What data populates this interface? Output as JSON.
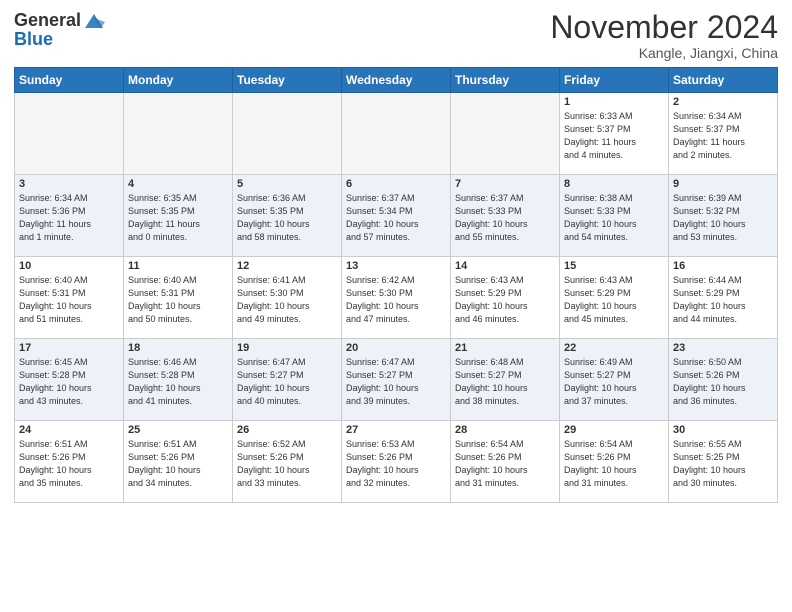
{
  "header": {
    "logo_general": "General",
    "logo_blue": "Blue",
    "month_title": "November 2024",
    "location": "Kangle, Jiangxi, China"
  },
  "weekdays": [
    "Sunday",
    "Monday",
    "Tuesday",
    "Wednesday",
    "Thursday",
    "Friday",
    "Saturday"
  ],
  "weeks": [
    [
      {
        "day": "",
        "info": ""
      },
      {
        "day": "",
        "info": ""
      },
      {
        "day": "",
        "info": ""
      },
      {
        "day": "",
        "info": ""
      },
      {
        "day": "",
        "info": ""
      },
      {
        "day": "1",
        "info": "Sunrise: 6:33 AM\nSunset: 5:37 PM\nDaylight: 11 hours\nand 4 minutes."
      },
      {
        "day": "2",
        "info": "Sunrise: 6:34 AM\nSunset: 5:37 PM\nDaylight: 11 hours\nand 2 minutes."
      }
    ],
    [
      {
        "day": "3",
        "info": "Sunrise: 6:34 AM\nSunset: 5:36 PM\nDaylight: 11 hours\nand 1 minute."
      },
      {
        "day": "4",
        "info": "Sunrise: 6:35 AM\nSunset: 5:35 PM\nDaylight: 11 hours\nand 0 minutes."
      },
      {
        "day": "5",
        "info": "Sunrise: 6:36 AM\nSunset: 5:35 PM\nDaylight: 10 hours\nand 58 minutes."
      },
      {
        "day": "6",
        "info": "Sunrise: 6:37 AM\nSunset: 5:34 PM\nDaylight: 10 hours\nand 57 minutes."
      },
      {
        "day": "7",
        "info": "Sunrise: 6:37 AM\nSunset: 5:33 PM\nDaylight: 10 hours\nand 55 minutes."
      },
      {
        "day": "8",
        "info": "Sunrise: 6:38 AM\nSunset: 5:33 PM\nDaylight: 10 hours\nand 54 minutes."
      },
      {
        "day": "9",
        "info": "Sunrise: 6:39 AM\nSunset: 5:32 PM\nDaylight: 10 hours\nand 53 minutes."
      }
    ],
    [
      {
        "day": "10",
        "info": "Sunrise: 6:40 AM\nSunset: 5:31 PM\nDaylight: 10 hours\nand 51 minutes."
      },
      {
        "day": "11",
        "info": "Sunrise: 6:40 AM\nSunset: 5:31 PM\nDaylight: 10 hours\nand 50 minutes."
      },
      {
        "day": "12",
        "info": "Sunrise: 6:41 AM\nSunset: 5:30 PM\nDaylight: 10 hours\nand 49 minutes."
      },
      {
        "day": "13",
        "info": "Sunrise: 6:42 AM\nSunset: 5:30 PM\nDaylight: 10 hours\nand 47 minutes."
      },
      {
        "day": "14",
        "info": "Sunrise: 6:43 AM\nSunset: 5:29 PM\nDaylight: 10 hours\nand 46 minutes."
      },
      {
        "day": "15",
        "info": "Sunrise: 6:43 AM\nSunset: 5:29 PM\nDaylight: 10 hours\nand 45 minutes."
      },
      {
        "day": "16",
        "info": "Sunrise: 6:44 AM\nSunset: 5:29 PM\nDaylight: 10 hours\nand 44 minutes."
      }
    ],
    [
      {
        "day": "17",
        "info": "Sunrise: 6:45 AM\nSunset: 5:28 PM\nDaylight: 10 hours\nand 43 minutes."
      },
      {
        "day": "18",
        "info": "Sunrise: 6:46 AM\nSunset: 5:28 PM\nDaylight: 10 hours\nand 41 minutes."
      },
      {
        "day": "19",
        "info": "Sunrise: 6:47 AM\nSunset: 5:27 PM\nDaylight: 10 hours\nand 40 minutes."
      },
      {
        "day": "20",
        "info": "Sunrise: 6:47 AM\nSunset: 5:27 PM\nDaylight: 10 hours\nand 39 minutes."
      },
      {
        "day": "21",
        "info": "Sunrise: 6:48 AM\nSunset: 5:27 PM\nDaylight: 10 hours\nand 38 minutes."
      },
      {
        "day": "22",
        "info": "Sunrise: 6:49 AM\nSunset: 5:27 PM\nDaylight: 10 hours\nand 37 minutes."
      },
      {
        "day": "23",
        "info": "Sunrise: 6:50 AM\nSunset: 5:26 PM\nDaylight: 10 hours\nand 36 minutes."
      }
    ],
    [
      {
        "day": "24",
        "info": "Sunrise: 6:51 AM\nSunset: 5:26 PM\nDaylight: 10 hours\nand 35 minutes."
      },
      {
        "day": "25",
        "info": "Sunrise: 6:51 AM\nSunset: 5:26 PM\nDaylight: 10 hours\nand 34 minutes."
      },
      {
        "day": "26",
        "info": "Sunrise: 6:52 AM\nSunset: 5:26 PM\nDaylight: 10 hours\nand 33 minutes."
      },
      {
        "day": "27",
        "info": "Sunrise: 6:53 AM\nSunset: 5:26 PM\nDaylight: 10 hours\nand 32 minutes."
      },
      {
        "day": "28",
        "info": "Sunrise: 6:54 AM\nSunset: 5:26 PM\nDaylight: 10 hours\nand 31 minutes."
      },
      {
        "day": "29",
        "info": "Sunrise: 6:54 AM\nSunset: 5:26 PM\nDaylight: 10 hours\nand 31 minutes."
      },
      {
        "day": "30",
        "info": "Sunrise: 6:55 AM\nSunset: 5:25 PM\nDaylight: 10 hours\nand 30 minutes."
      }
    ]
  ]
}
